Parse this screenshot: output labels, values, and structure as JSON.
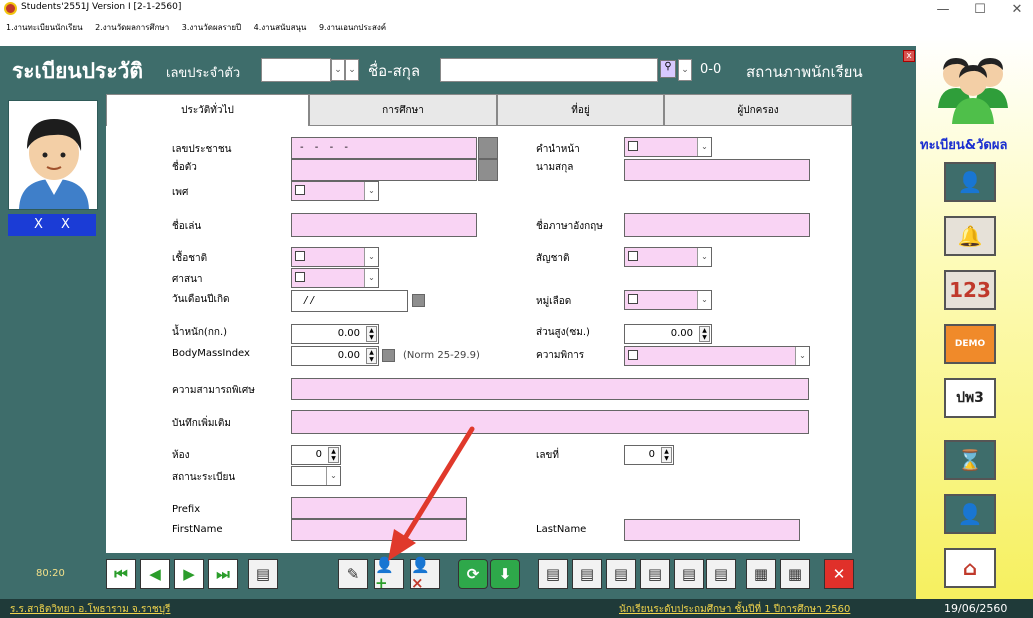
{
  "window": {
    "title": "Students'2551J Version I [2-1-2560]",
    "minimize": "—",
    "maximize": "☐",
    "close": "✕"
  },
  "menu": [
    "1.งานทะเบียนนักเรียน",
    "2.งานวัดผลการศึกษา",
    "3.งานวัดผลรายปี",
    "4.งานสนับสนุน",
    "9.งานเอนกประสงค์"
  ],
  "header": {
    "title": "ระเบียนประวัติ",
    "student_id_label": "เลขประจำตัว",
    "student_id_value": "",
    "name_label": "ชื่อ-สกุล",
    "name_value": "",
    "count": "0-0",
    "status_label": "สถานภาพนักเรียน",
    "close_label": "x"
  },
  "left": {
    "id_display": "X X"
  },
  "tabs": [
    "ประวัติทั่วไป",
    "การศึกษา",
    "ที่อยู่",
    "ผู้ปกครอง"
  ],
  "form": {
    "citizen_id": {
      "label": "เลขประชาชน",
      "value": "- - - -"
    },
    "first_name": {
      "label": "ชื่อตัว",
      "value": ""
    },
    "gender": {
      "label": "เพศ"
    },
    "title_prefix": {
      "label": "คำนำหน้า"
    },
    "last_name": {
      "label": "นามสกุล",
      "value": ""
    },
    "nickname": {
      "label": "ชื่อเล่น",
      "value": ""
    },
    "english_name": {
      "label": "ชื่อภาษาอังกฤษ",
      "value": ""
    },
    "ethnicity": {
      "label": "เชื้อชาติ"
    },
    "nationality": {
      "label": "สัญชาติ"
    },
    "religion": {
      "label": "ศาสนา"
    },
    "birthdate": {
      "label": "วันเดือนปีเกิด",
      "value": "/ /"
    },
    "blood_type": {
      "label": "หมู่เลือด"
    },
    "weight": {
      "label": "น้ำหนัก(กก.)",
      "value": "0.00"
    },
    "height": {
      "label": "ส่วนสูง(ซม.)",
      "value": "0.00"
    },
    "bmi": {
      "label": "BodyMassIndex",
      "value": "0.00",
      "norm": "(Norm 25-29.9)"
    },
    "disability": {
      "label": "ความพิการ"
    },
    "talent": {
      "label": "ความสามารถพิเศษ",
      "value": ""
    },
    "notes": {
      "label": "บันทึกเพิ่มเติม",
      "value": ""
    },
    "room": {
      "label": "ห้อง",
      "value": "0"
    },
    "number": {
      "label": "เลขที่",
      "value": "0"
    },
    "reg_status": {
      "label": "สถานะระเบียน"
    },
    "prefix_en": {
      "label": "Prefix",
      "value": ""
    },
    "firstname_en": {
      "label": "FirstName",
      "value": ""
    },
    "lastname_en": {
      "label": "LastName",
      "value": ""
    }
  },
  "sidebar": {
    "title": "ทะเบียน&วัดผล",
    "buttons": [
      "student",
      "bell",
      "123",
      "DEMO",
      "ปพ3",
      "hourglass",
      "teacher",
      "home"
    ],
    "labels": {
      "numbers": "123",
      "demo": "DEMO",
      "pp3": "ปพ3"
    }
  },
  "toolbar": {
    "clock": "80:20"
  },
  "status": {
    "school": "ร.ร.สาธิตวิทยา อ.โพธาราม จ.ราชบุรี",
    "level": "นักเรียนระดับประถมศึกษา ชั้นปีที่ 1 ปีการศึกษา 2560",
    "date": "19/06/2560"
  },
  "colors": {
    "header": "#3e6d6b",
    "field": "#f9d4f4",
    "sidebar_title": "#1b2fd0",
    "annotation_arrow": "#e0392b"
  }
}
